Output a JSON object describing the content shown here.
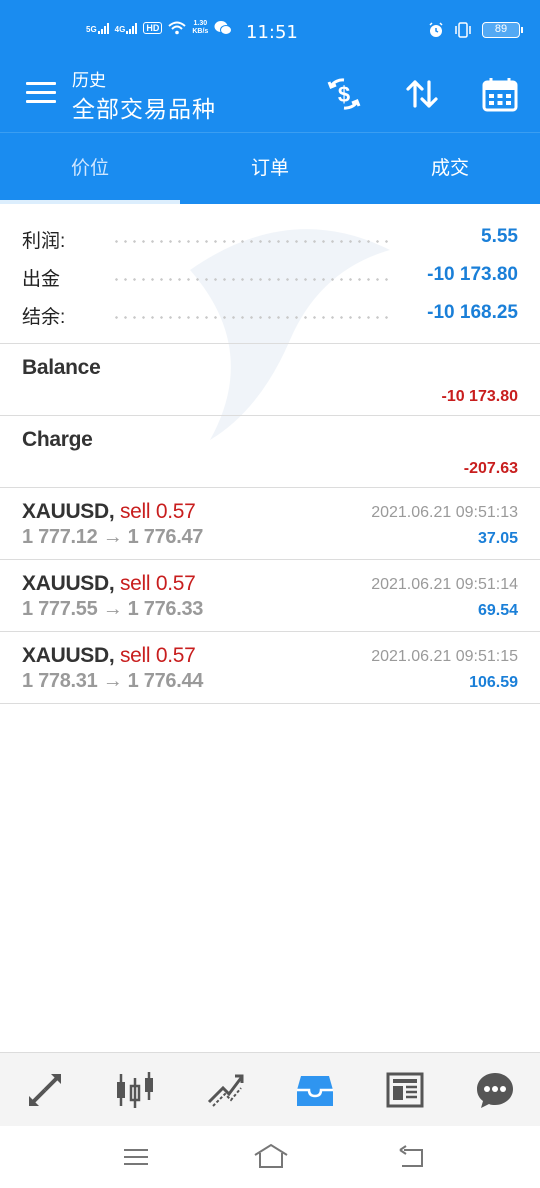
{
  "status_bar": {
    "network_1": "5G",
    "network_2": "4G",
    "hd": "HD",
    "speed": "1.30",
    "speed_unit": "KB/s",
    "time": "11:51",
    "battery": "89"
  },
  "app_bar": {
    "subtitle": "历史",
    "title": "全部交易品种"
  },
  "tabs": [
    {
      "label": "价位"
    },
    {
      "label": "订单"
    },
    {
      "label": "成交"
    }
  ],
  "summary": [
    {
      "label": "利润:",
      "value": "5.55"
    },
    {
      "label": "出金",
      "value": "-10 173.80"
    },
    {
      "label": "结余:",
      "value": "-10 168.25"
    }
  ],
  "deals": [
    {
      "name": "Balance",
      "amount": "-10 173.80"
    },
    {
      "name": "Charge",
      "amount": "-207.63"
    }
  ],
  "trades": [
    {
      "symbol": "XAUUSD,",
      "side": "sell 0.57",
      "prices": "1 777.12 → 1 776.47",
      "time": "2021.06.21 09:51:13",
      "profit": "37.05"
    },
    {
      "symbol": "XAUUSD,",
      "side": "sell 0.57",
      "prices": "1 777.55 → 1 776.33",
      "time": "2021.06.21 09:51:14",
      "profit": "69.54"
    },
    {
      "symbol": "XAUUSD,",
      "side": "sell 0.57",
      "prices": "1 778.31 → 1 776.44",
      "time": "2021.06.21 09:51:15",
      "profit": "106.59"
    }
  ],
  "bottom_nav": [
    "quotes-icon",
    "chart-icon",
    "trade-icon",
    "history-icon",
    "news-icon",
    "chat-icon"
  ],
  "colors": {
    "accent": "#1a8cf0",
    "positive": "#1a7fd8",
    "negative": "#c81e1e",
    "active_nav": "#2f95f0"
  }
}
